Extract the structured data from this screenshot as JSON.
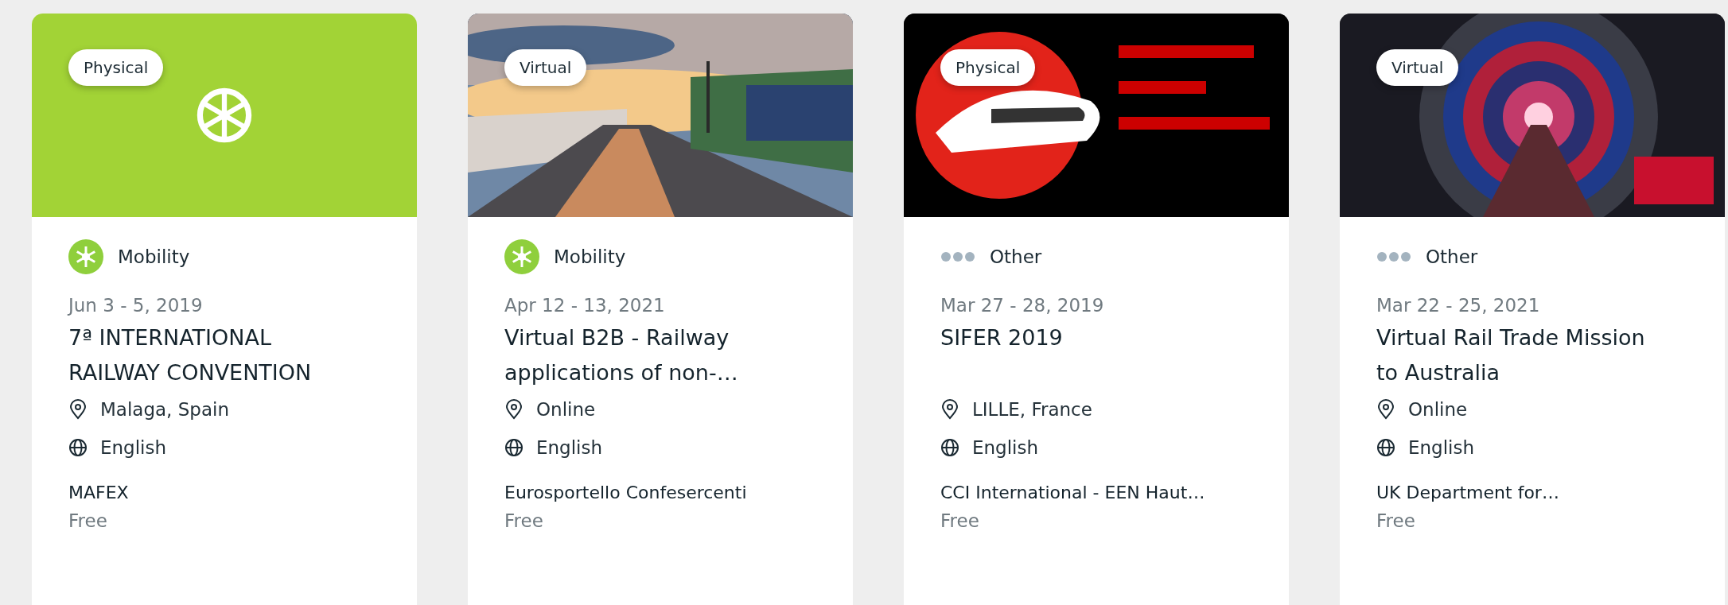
{
  "cards": [
    {
      "header": {
        "kind": "category",
        "color": "#a2d336"
      },
      "format_badge": "Physical",
      "category": {
        "kind": "mobility",
        "label": "Mobility"
      },
      "date": "Jun 3 - 5, 2019",
      "title": "7ª INTERNATIONAL RAILWAY CONVENTION",
      "location": "Malaga, Spain",
      "language": "English",
      "organizer": "MAFEX",
      "price": "Free"
    },
    {
      "header": {
        "kind": "station"
      },
      "format_badge": "Virtual",
      "category": {
        "kind": "mobility",
        "label": "Mobility"
      },
      "date": "Apr 12 - 13, 2021",
      "title": "Virtual B2B - Railway applications of non-…",
      "location": "Online",
      "language": "English",
      "organizer": "Eurosportello Confesercenti",
      "price": "Free"
    },
    {
      "header": {
        "kind": "poster"
      },
      "format_badge": "Physical",
      "category": {
        "kind": "other",
        "label": "Other"
      },
      "date": "Mar 27 - 28, 2019",
      "title": "SIFER 2019",
      "location": "LILLE, France",
      "language": "English",
      "organizer": "CCI International - EEN Haut…",
      "price": "Free"
    },
    {
      "header": {
        "kind": "tunnel"
      },
      "format_badge": "Virtual",
      "category": {
        "kind": "other",
        "label": "Other"
      },
      "date": "Mar 22 - 25, 2021",
      "title": "Virtual Rail Trade Mission to Australia",
      "location": "Online",
      "language": "English",
      "organizer": "UK Department for…",
      "price": "Free"
    }
  ]
}
